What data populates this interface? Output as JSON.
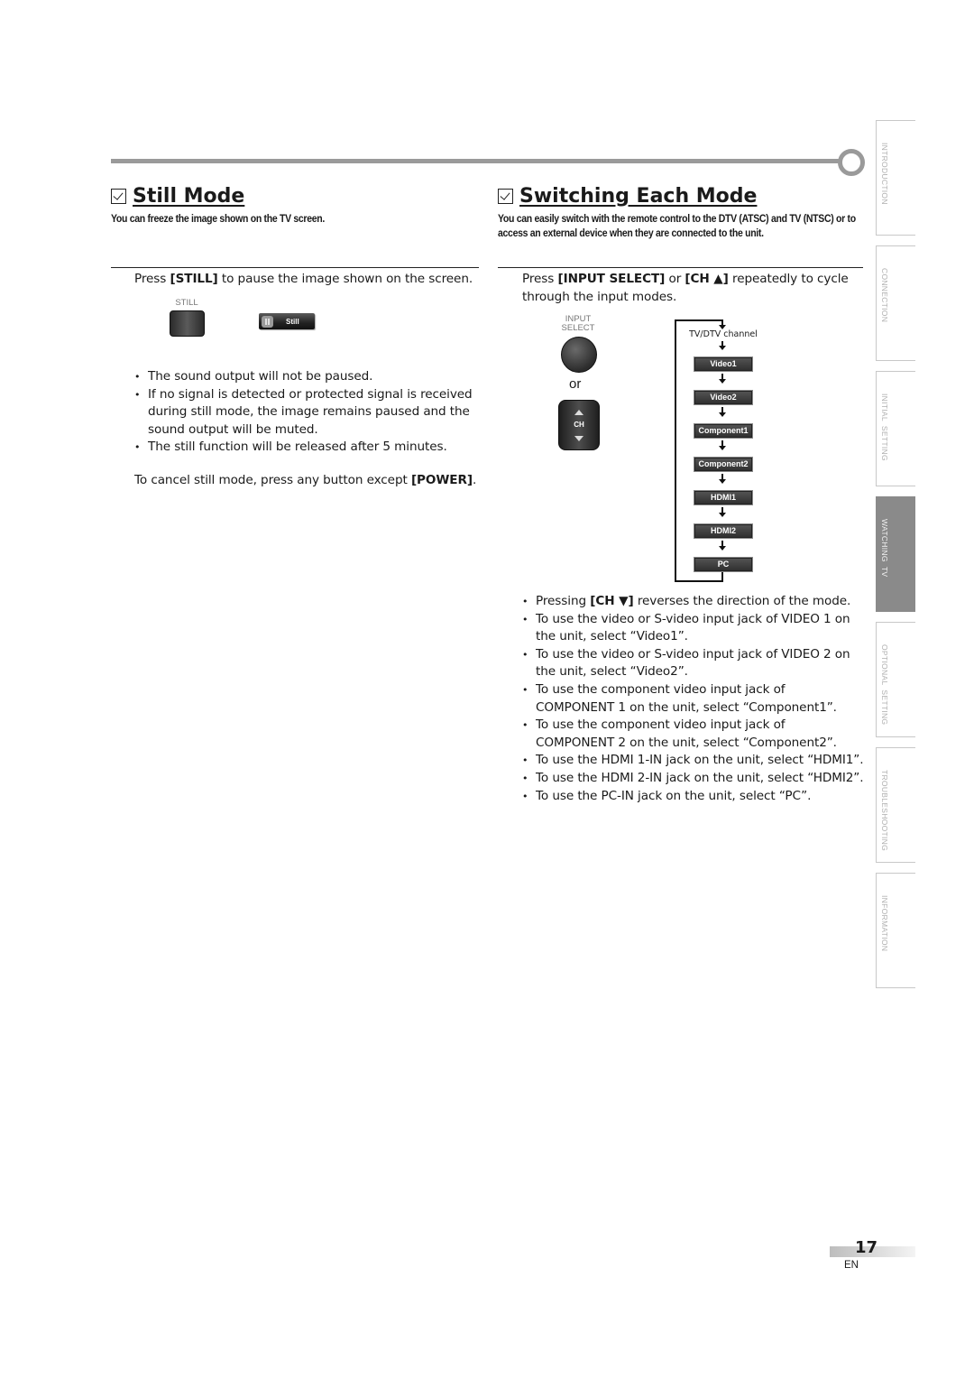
{
  "still_mode": {
    "title": "Still Mode",
    "subtitle": "You can freeze the image shown on the TV screen.",
    "instruction_pre": "Press ",
    "instruction_key": "[STILL]",
    "instruction_post": " to pause the image shown on the screen.",
    "remote_button_caption": "STILL",
    "osd_label": "Still",
    "bullets": [
      "The sound output will not be paused.",
      "If no signal is detected or protected signal is received during still mode, the image remains paused and the sound output will be muted.",
      "The still function will be released after 5 minutes."
    ],
    "cancel_pre": "To cancel still mode, press any button except ",
    "cancel_key": "[POWER]",
    "cancel_post": "."
  },
  "switching_mode": {
    "title": "Switching Each Mode",
    "subtitle": "You can easily switch with the remote control to the DTV (ATSC) and TV (NTSC) or to access an external device when they are connected to the unit.",
    "instruction_pre": "Press ",
    "instruction_key1": "[INPUT SELECT]",
    "instruction_mid": " or ",
    "instruction_key2": "[CH ▲]",
    "instruction_post": " repeatedly to cycle through the input modes.",
    "input_button_caption_line1": "INPUT",
    "input_button_caption_line2": "SELECT",
    "or_label": "or",
    "ch_button_label": "CH",
    "flow_start": "TV/DTV channel",
    "flow_nodes": [
      "Video1",
      "Video2",
      "Component1",
      "Component2",
      "HDMI1",
      "HDMI2",
      "PC"
    ],
    "bullet_first_pre": "Pressing ",
    "bullet_first_key": "[CH ▼]",
    "bullet_first_post": " reverses the direction of the mode.",
    "bullets": [
      "To use the video or S-video input jack of VIDEO 1 on the unit, select “Video1”.",
      "To use the video or S-video input jack of VIDEO 2 on the unit, select “Video2”.",
      "To use the component video input jack of COMPONENT 1 on the unit, select “Component1”.",
      "To use the component video input jack of COMPONENT 2 on the unit, select “Component2”.",
      "To use the HDMI 1-IN jack on the unit, select “HDMI1”.",
      "To use the HDMI 2-IN jack on the unit, select “HDMI2”.",
      "To use the PC-IN jack on the unit, select “PC”."
    ]
  },
  "side_tabs": [
    {
      "label": "INTRODUCTION",
      "active": false
    },
    {
      "label": "CONNECTION",
      "active": false
    },
    {
      "label": "INITIAL  SETTING",
      "active": false
    },
    {
      "label": "WATCHING  TV",
      "active": true
    },
    {
      "label": "OPTIONAL  SETTING",
      "active": false
    },
    {
      "label": "TROUBLESHOOTING",
      "active": false
    },
    {
      "label": "INFORMATION",
      "active": false
    }
  ],
  "footer": {
    "page_number": "17",
    "language": "EN"
  },
  "colors": {
    "rule_gray": "#9a9a9a",
    "active_tab": "#8a8a8a",
    "tab_text": "#b0b0b0"
  }
}
